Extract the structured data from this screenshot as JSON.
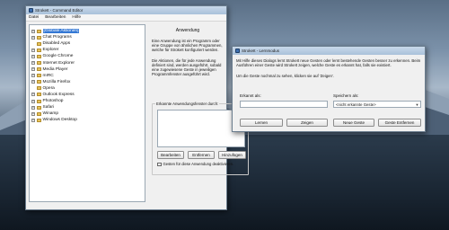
{
  "editor": {
    "title": "StrokeIt - Command Editor",
    "menu": [
      "Datei",
      "Bearbeiten",
      "Hilfe"
    ],
    "tree": [
      {
        "label": "[Globale Aktionen]",
        "expander": "+",
        "selected": true
      },
      {
        "label": "Chat Programs",
        "expander": "+"
      },
      {
        "label": "Disabled Apps",
        "expander": ""
      },
      {
        "label": "Explorer",
        "expander": "+"
      },
      {
        "label": "Google Chrome",
        "expander": "+"
      },
      {
        "label": "Internet Explorer",
        "expander": "+"
      },
      {
        "label": "Media Player",
        "expander": "+"
      },
      {
        "label": "mIRC",
        "expander": "+"
      },
      {
        "label": "Mozilla Firefox",
        "expander": "+"
      },
      {
        "label": "Opera",
        "expander": ""
      },
      {
        "label": "Outlook Express",
        "expander": "+"
      },
      {
        "label": "Photoshop",
        "expander": "+"
      },
      {
        "label": "Safari",
        "expander": "+"
      },
      {
        "label": "Winamp",
        "expander": "+"
      },
      {
        "label": "Windows Desktop",
        "expander": "+"
      }
    ],
    "section_title": "Anwendung",
    "para1": "Eine Anwendung ist ein Programm oder eine Gruppe von ähnlichen Programmen, welche für StrokeIt konfiguriert werden.",
    "para2": "Die Aktionen, die für jede Anwendung definiert sind, werden ausgeführt, sobald eine zugewiesene Geste in jeweiligen Programmfenster ausgeführt wird.",
    "groupbox_label": "Erkannte Anwendungsfenster durch:",
    "btn_edit": "Bearbeiten",
    "btn_remove": "Entfernen",
    "btn_add": "Hinzufügen",
    "checkbox_text": "Gesten für diese Anwendung deaktivieren."
  },
  "learn": {
    "title": "StrokeIt - Lernmodus",
    "para1": "Mit Hilfe dieses Dialogs lernt StrokeIt neue Gesten oder lernt bestehende Gesten besser zu erkennen. Beim Ausführen einer Geste wird StrokeIt zeigen, welche Geste es erkannt hat, falls sie existiert.",
    "para2": "Um die Geste nochmal zu sehen, klicken sie auf 'Zeigen'.",
    "recognized_label": "Erkannt als:",
    "save_label": "Speichern als:",
    "combo_value": "<nicht erkannte Geste>",
    "btn_learn": "Lernen",
    "btn_show": "Zeigen",
    "btn_new": "Neue Geste",
    "btn_remove": "Geste Entfernen"
  }
}
